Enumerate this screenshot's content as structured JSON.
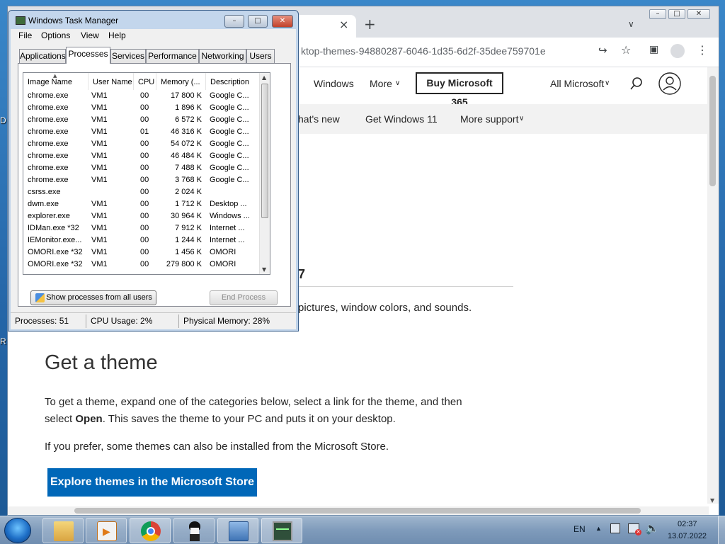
{
  "desktop": {
    "letters": [
      "D",
      "R"
    ]
  },
  "browser": {
    "url_fragment": "ktop-themes-94880287-6046-1d35-6d2f-35dee759701e",
    "tab_close": "×",
    "new_tab": "+",
    "nav": {
      "windows": "Windows",
      "more": "More",
      "buy": "Buy Microsoft 365",
      "all_microsoft": "All Microsoft"
    },
    "subnav": {
      "whats_new": "hat's new",
      "get_windows": "Get Windows 11",
      "more_support": "More support"
    },
    "partial_heading": "7",
    "intro_fragment": "pictures, window colors, and sounds.",
    "heading": "Get a theme",
    "para1_a": "To get a theme, expand one of the categories below, select a link for the theme, and then",
    "para1_b_pre": "select ",
    "para1_b_bold": "Open",
    "para1_b_post": ". This saves the theme to your PC and puts it on your desktop.",
    "para2": "If you prefer, some themes can also be installed from the Microsoft Store.",
    "store_button": "Explore themes in the Microsoft Store",
    "colors": {
      "store_button": "#0067b8"
    }
  },
  "taskmgr": {
    "title": "Windows Task Manager",
    "menu": [
      "File",
      "Options",
      "View",
      "Help"
    ],
    "tabs": [
      "Applications",
      "Processes",
      "Services",
      "Performance",
      "Networking",
      "Users"
    ],
    "active_tab": "Processes",
    "columns": [
      "Image Name",
      "User Name",
      "CPU",
      "Memory (...",
      "Description"
    ],
    "rows": [
      [
        "chrome.exe",
        "VM1",
        "00",
        "17 800 K",
        "Google C..."
      ],
      [
        "chrome.exe",
        "VM1",
        "00",
        "1 896 K",
        "Google C..."
      ],
      [
        "chrome.exe",
        "VM1",
        "00",
        "6 572 K",
        "Google C..."
      ],
      [
        "chrome.exe",
        "VM1",
        "01",
        "46 316 K",
        "Google C..."
      ],
      [
        "chrome.exe",
        "VM1",
        "00",
        "54 072 K",
        "Google C..."
      ],
      [
        "chrome.exe",
        "VM1",
        "00",
        "46 484 K",
        "Google C..."
      ],
      [
        "chrome.exe",
        "VM1",
        "00",
        "7 488 K",
        "Google C..."
      ],
      [
        "chrome.exe",
        "VM1",
        "00",
        "3 768 K",
        "Google C..."
      ],
      [
        "csrss.exe",
        "",
        "00",
        "2 024 K",
        ""
      ],
      [
        "dwm.exe",
        "VM1",
        "00",
        "1 712 K",
        "Desktop ..."
      ],
      [
        "explorer.exe",
        "VM1",
        "00",
        "30 964 K",
        "Windows ..."
      ],
      [
        "IDMan.exe *32",
        "VM1",
        "00",
        "7 912 K",
        "Internet ..."
      ],
      [
        "IEMonitor.exe...",
        "VM1",
        "00",
        "1 244 K",
        "Internet ..."
      ],
      [
        "OMORI.exe *32",
        "VM1",
        "00",
        "1 456 K",
        "OMORI"
      ],
      [
        "OMORI.exe *32",
        "VM1",
        "00",
        "279 800 K",
        "OMORI"
      ]
    ],
    "show_all_button": "Show processes from all users",
    "end_process_button": "End Process",
    "status": {
      "processes": "Processes: 51",
      "cpu": "CPU Usage: 2%",
      "memory": "Physical Memory: 28%"
    }
  },
  "taskbar": {
    "apps": [
      "explorer-icon",
      "media-player-icon",
      "chrome-icon",
      "omori-icon",
      "remote-desktop-icon",
      "task-manager-icon"
    ],
    "language": "EN",
    "time": "02:37",
    "date": "13.07.2022"
  }
}
